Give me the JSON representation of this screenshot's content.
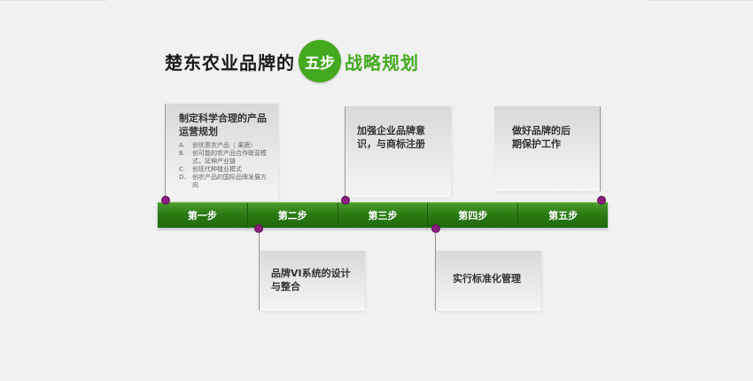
{
  "title": {
    "prefix": "楚东农业品牌的",
    "highlight": "五步",
    "suffix": "战略规划"
  },
  "steps": [
    {
      "label": "第一步"
    },
    {
      "label": "第二步"
    },
    {
      "label": "第三步"
    },
    {
      "label": "第四步"
    },
    {
      "label": "第五步"
    }
  ],
  "cards": {
    "step1": {
      "heading": "制定科学合理的产品运营规划",
      "items": [
        {
          "marker": "A.",
          "text": "创优质农产品（  果蔬）"
        },
        {
          "marker": "B.",
          "text": "创可能的农产品合作联营模式，延伸产业链"
        },
        {
          "marker": "C.",
          "text": "创现代种植业模式"
        },
        {
          "marker": "D.",
          "text": "创农产品的国际品牌发展方向"
        }
      ]
    },
    "step2": {
      "heading": "品牌VI系统的设计与整合"
    },
    "step3": {
      "heading": "加强企业品牌意识，与商标注册"
    },
    "step4": {
      "heading": "实行标准化管理"
    },
    "step5": {
      "heading": "做好品牌的后期保护工作"
    }
  },
  "colors": {
    "accent_green": "#44a91e",
    "timeline_green": "#2b7a14",
    "dot_purple": "#8b1d7f",
    "background": "#f1f1f1"
  }
}
